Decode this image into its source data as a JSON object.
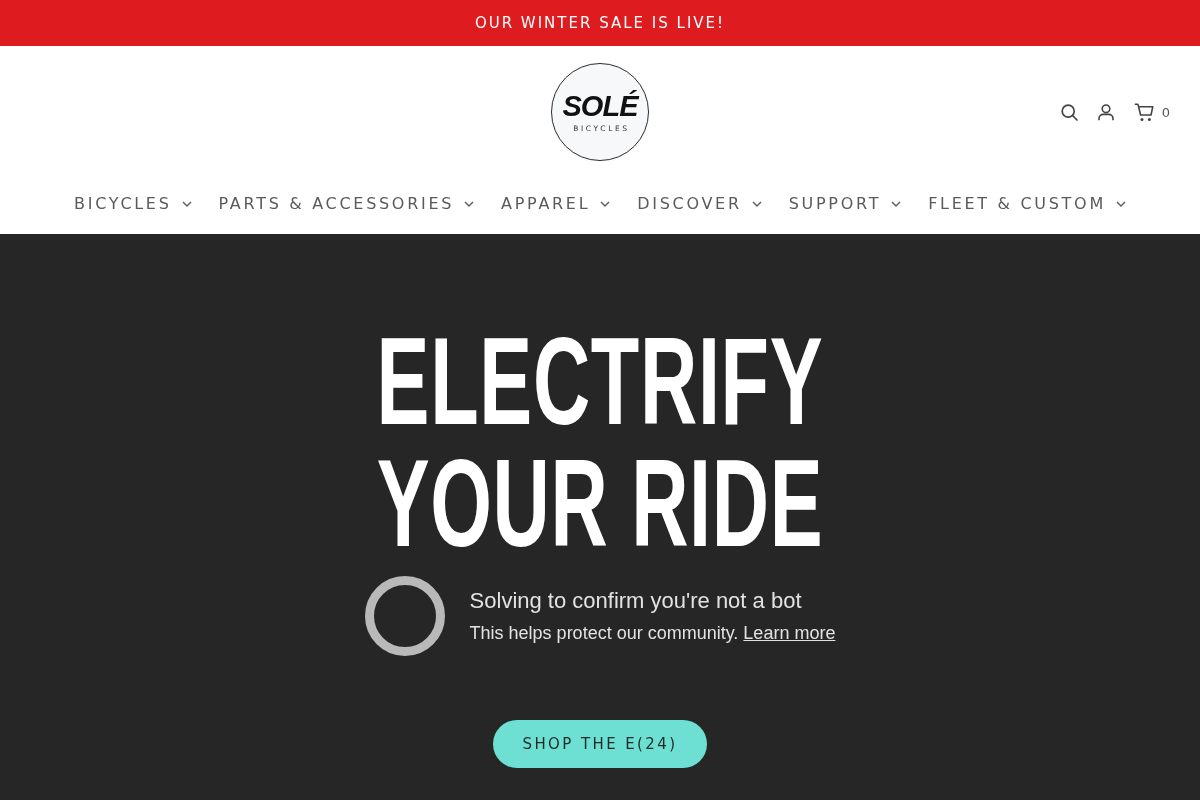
{
  "announcement": {
    "text": "OUR WINTER SALE IS LIVE!"
  },
  "header": {
    "logo": {
      "wordmark": "SOLÉ",
      "subtitle": "BICYCLES"
    },
    "cart_count": "0"
  },
  "nav": [
    {
      "label": "BICYCLES",
      "dropdown": true
    },
    {
      "label": "PARTS & ACCESSORIES",
      "dropdown": true
    },
    {
      "label": "APPAREL",
      "dropdown": true
    },
    {
      "label": "DISCOVER",
      "dropdown": true
    },
    {
      "label": "SUPPORT",
      "dropdown": true
    },
    {
      "label": "FLEET & CUSTOM",
      "dropdown": true
    }
  ],
  "hero": {
    "heading_lines": [
      "ELECTRIFY",
      "YOUR RIDE"
    ],
    "bot_check": {
      "title": "Solving to confirm you're not a bot",
      "message": "This helps protect our community.",
      "link": "Learn more"
    },
    "button": "SHOP THE E(24)"
  }
}
